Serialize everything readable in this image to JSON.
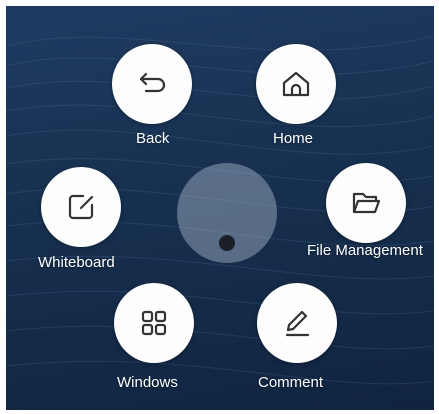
{
  "menu": {
    "items": [
      {
        "id": "back",
        "label": "Back",
        "icon": "back-arrow-icon"
      },
      {
        "id": "home",
        "label": "Home",
        "icon": "home-icon"
      },
      {
        "id": "whiteboard",
        "label": "Whiteboard",
        "icon": "whiteboard-icon"
      },
      {
        "id": "file-management",
        "label": "File Management",
        "icon": "folder-icon"
      },
      {
        "id": "windows",
        "label": "Windows",
        "icon": "windows-grid-icon"
      },
      {
        "id": "comment",
        "label": "Comment",
        "icon": "pen-icon"
      }
    ]
  },
  "colors": {
    "background": "#17304f",
    "button": "#fdfdfd",
    "icon_stroke": "#333333",
    "label": "#ffffff"
  }
}
